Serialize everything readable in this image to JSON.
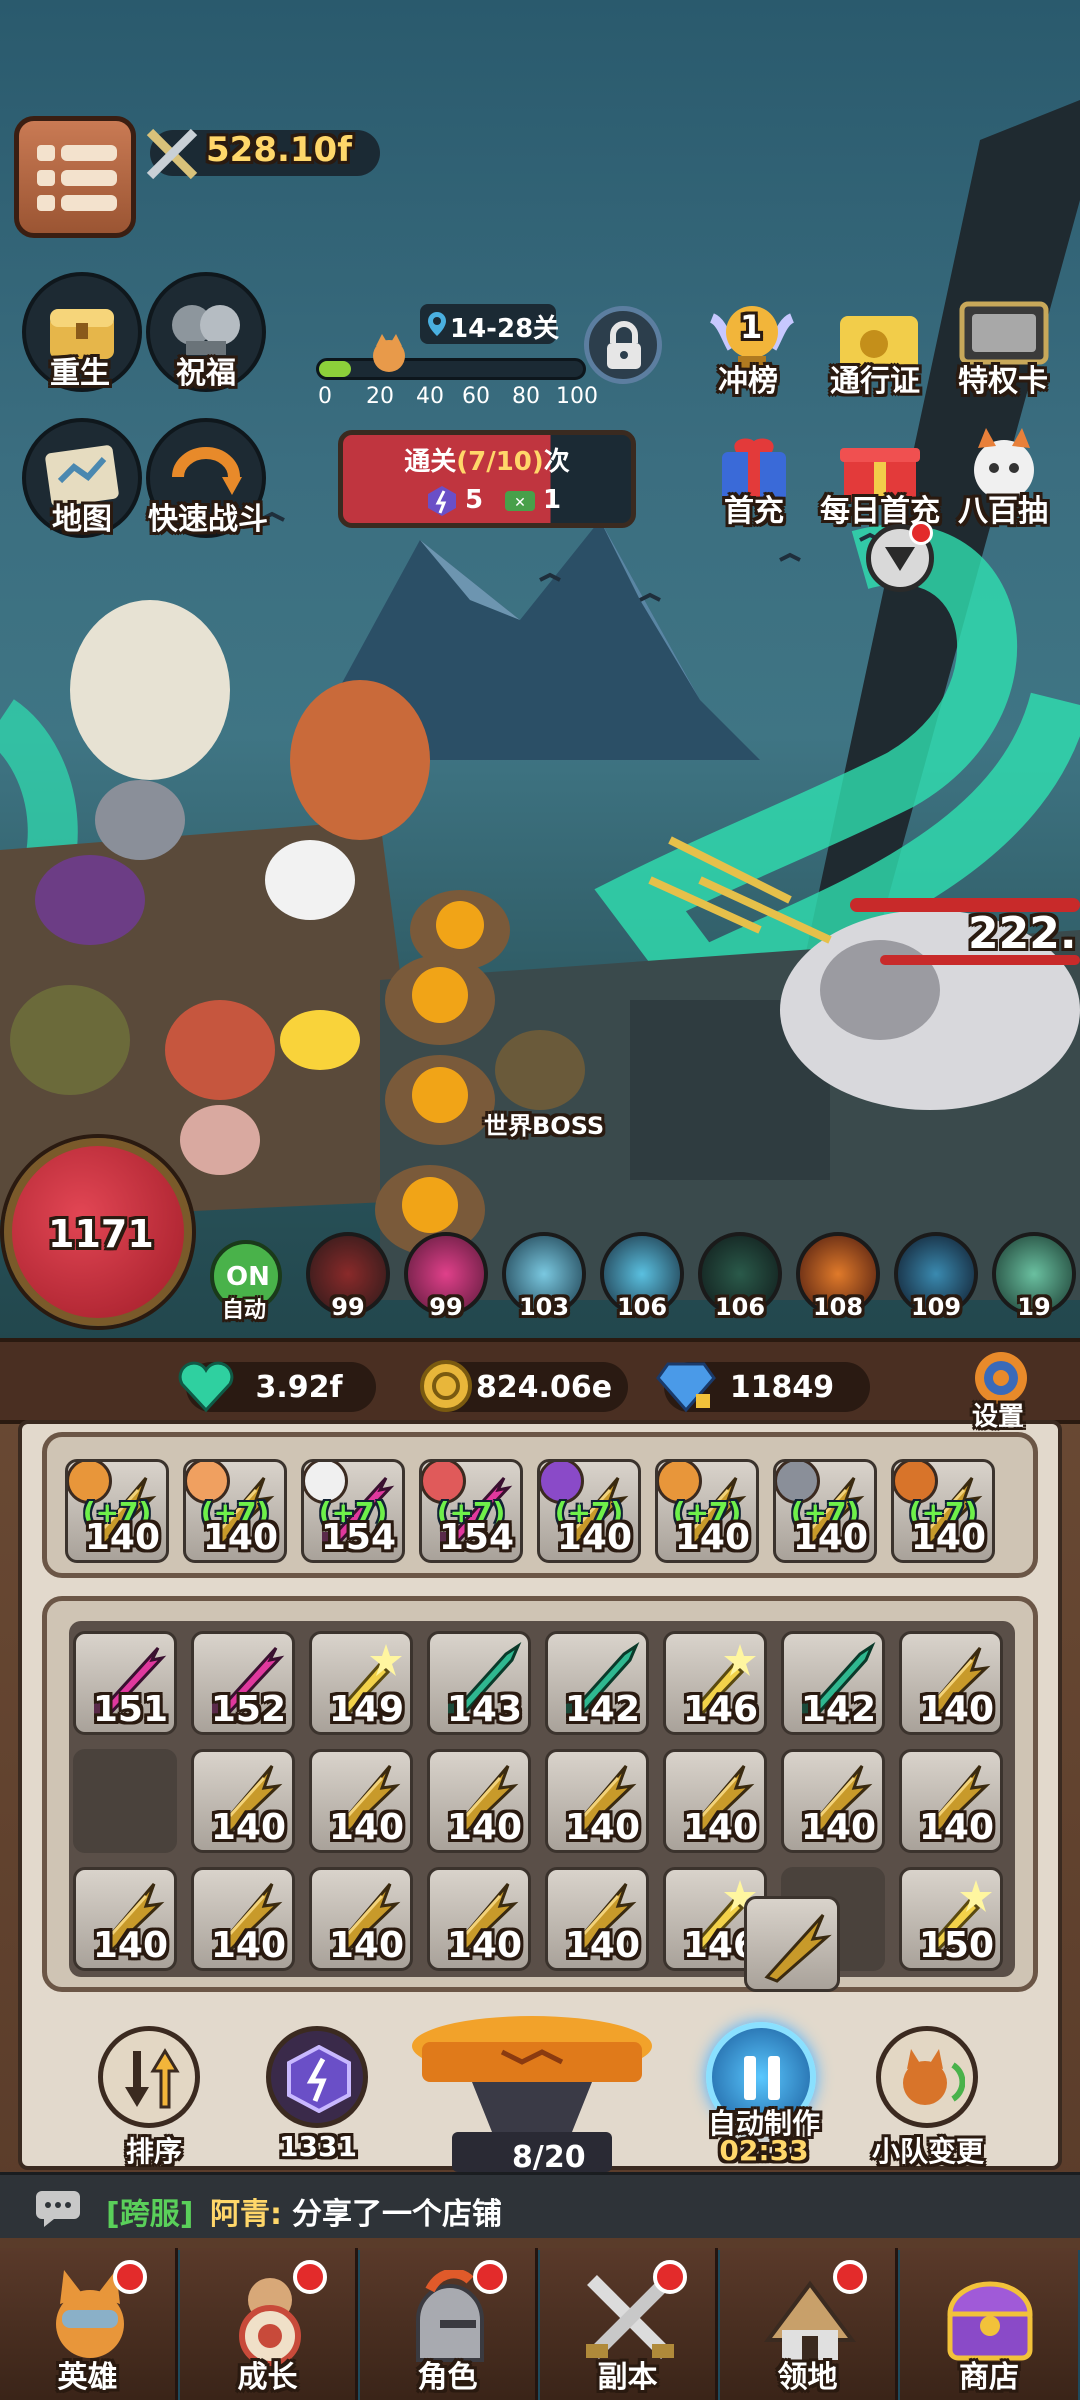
{
  "header": {
    "power": "528.10f",
    "stage_range": "14-28关",
    "progress_ticks": [
      "0",
      "20",
      "40",
      "60",
      "80",
      "100"
    ],
    "progress_fraction": 0.12
  },
  "left_buttons": [
    {
      "label": "重生",
      "icon": "treasure-chest-icon"
    },
    {
      "label": "祝福",
      "icon": "blessing-icon"
    },
    {
      "label": "地图",
      "icon": "map-icon"
    },
    {
      "label": "快速战斗",
      "icon": "fast-battle-icon"
    }
  ],
  "clear_box": {
    "prefix": "通关",
    "count": "(7/10)",
    "suffix": "次",
    "energy": "5",
    "tickets": "1"
  },
  "right_buttons": [
    {
      "label": "冲榜",
      "icon": "rank-trophy-icon",
      "badge": "1"
    },
    {
      "label": "通行证",
      "icon": "pass-ticket-icon"
    },
    {
      "label": "特权卡",
      "icon": "privilege-card-icon"
    },
    {
      "label": "首充",
      "icon": "first-recharge-icon"
    },
    {
      "label": "每日首充",
      "icon": "daily-gift-icon"
    },
    {
      "label": "八百抽",
      "icon": "summon-icon"
    }
  ],
  "battle": {
    "damage_text": "222.",
    "world_boss_label": "世界BOSS"
  },
  "hp_orb": {
    "value": "1171"
  },
  "auto_toggle": {
    "state": "ON",
    "label": "自动"
  },
  "hero_bar": [
    "99",
    "99",
    "103",
    "106",
    "106",
    "108",
    "109",
    "19"
  ],
  "resources": {
    "gems": "3.92f",
    "coins": "824.06e",
    "diamonds": "11849",
    "settings_label": "设置"
  },
  "equipped": [
    {
      "bonus": "(+7)",
      "level": "140"
    },
    {
      "bonus": "(+7)",
      "level": "140"
    },
    {
      "bonus": "(+7)",
      "level": "154"
    },
    {
      "bonus": "(+7)",
      "level": "154"
    },
    {
      "bonus": "(+7)",
      "level": "140"
    },
    {
      "bonus": "(+7)",
      "level": "140"
    },
    {
      "bonus": "(+7)",
      "level": "140"
    },
    {
      "bonus": "(+7)",
      "level": "140"
    }
  ],
  "inventory": [
    [
      "151",
      "152",
      "149",
      "143",
      "142",
      "146",
      "142",
      "140"
    ],
    [
      "",
      "140",
      "140",
      "140",
      "140",
      "140",
      "140",
      "140"
    ],
    [
      "140",
      "140",
      "140",
      "140",
      "140",
      "146",
      "",
      "150"
    ]
  ],
  "controls": {
    "sort_label": "排序",
    "energy_count": "1331",
    "forge_count": "8/20",
    "auto_craft_label": "自动制作",
    "auto_craft_timer": "02:33",
    "team_label": "小队变更"
  },
  "chat": {
    "channel": "[跨服]",
    "user": "阿青:",
    "message": "分享了一个店铺"
  },
  "bottom_nav": [
    {
      "label": "英雄",
      "icon": "hero-fox-icon"
    },
    {
      "label": "成长",
      "icon": "growth-target-icon"
    },
    {
      "label": "角色",
      "icon": "knight-helmet-icon"
    },
    {
      "label": "副本",
      "icon": "crossed-swords-icon"
    },
    {
      "label": "领地",
      "icon": "territory-tent-icon"
    },
    {
      "label": "商店",
      "icon": "shop-chest-icon"
    }
  ],
  "colors": {
    "gold_text": "#ffd76a",
    "accent_green": "#6ef04a",
    "notify_red": "#e32b2b",
    "hp_red": "#c2232d",
    "pink_weapon": "#e0389e",
    "teal_weapon": "#2fb890",
    "gold_weapon": "#c89a2a"
  }
}
